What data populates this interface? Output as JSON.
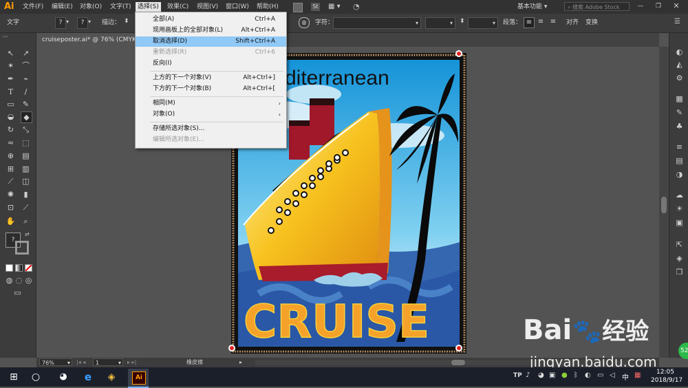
{
  "app": {
    "logo": "Ai",
    "doc_tab": "cruiseposter.ai* @ 76% (CMYK/"
  },
  "menubar": {
    "items": [
      "文件(F)",
      "编辑(E)",
      "对象(O)",
      "文字(T)",
      "选择(S)",
      "效果(C)",
      "视图(V)",
      "窗口(W)",
      "帮助(H)"
    ],
    "workspace": "基本功能",
    "search_placeholder": "搜索 Adobe Stock",
    "st_badge": "St"
  },
  "controlbar": {
    "selection_label": "文字",
    "stroke_label": "描边：",
    "char_label": "字符：",
    "para_label": "段落：",
    "align_label": "对齐",
    "transform_label": "变换",
    "q_mark": "?"
  },
  "dropdown": {
    "items": [
      {
        "label": "全部(A)",
        "shortcut": "Ctrl+A",
        "enabled": true
      },
      {
        "label": "现用画板上的全部对象(L)",
        "shortcut": "Alt+Ctrl+A",
        "enabled": true
      },
      {
        "label": "取消选择(D)",
        "shortcut": "Shift+Ctrl+A",
        "enabled": true,
        "highlighted": true
      },
      {
        "label": "重新选择(R)",
        "shortcut": "Ctrl+6",
        "enabled": false
      },
      {
        "label": "反向(I)",
        "shortcut": "",
        "enabled": true
      },
      {
        "label": "上方的下一个对象(V)",
        "shortcut": "Alt+Ctrl+]",
        "enabled": true
      },
      {
        "label": "下方的下一个对象(B)",
        "shortcut": "Alt+Ctrl+[",
        "enabled": true
      },
      {
        "label": "相同(M)",
        "shortcut": "",
        "enabled": true,
        "submenu": true
      },
      {
        "label": "对象(O)",
        "shortcut": "",
        "enabled": true,
        "submenu": true
      },
      {
        "label": "存储所选对象(S)...",
        "shortcut": "",
        "enabled": true
      },
      {
        "label": "编辑所选对象(E)...",
        "shortcut": "",
        "enabled": false
      }
    ]
  },
  "poster": {
    "title_text": "diterranean",
    "main_text": "CRUISE",
    "colors": {
      "sky": "#29a8e0",
      "ship": "#f5b51e",
      "hull": "#b01e2e",
      "sea": "#2a5aa8",
      "text": "#f59a2a",
      "palm": "#0a0a0a"
    }
  },
  "statusbar": {
    "zoom": "76%",
    "page": "1",
    "tool_name": "橡皮擦"
  },
  "taskbar": {
    "time": "12:05",
    "date": "2018/9/17",
    "ime": "中",
    "ai_label": "Ai"
  },
  "watermark": {
    "brand": "Bai",
    "brand2": "经验",
    "url": "jingyan.baidu.com",
    "badge": "52"
  }
}
